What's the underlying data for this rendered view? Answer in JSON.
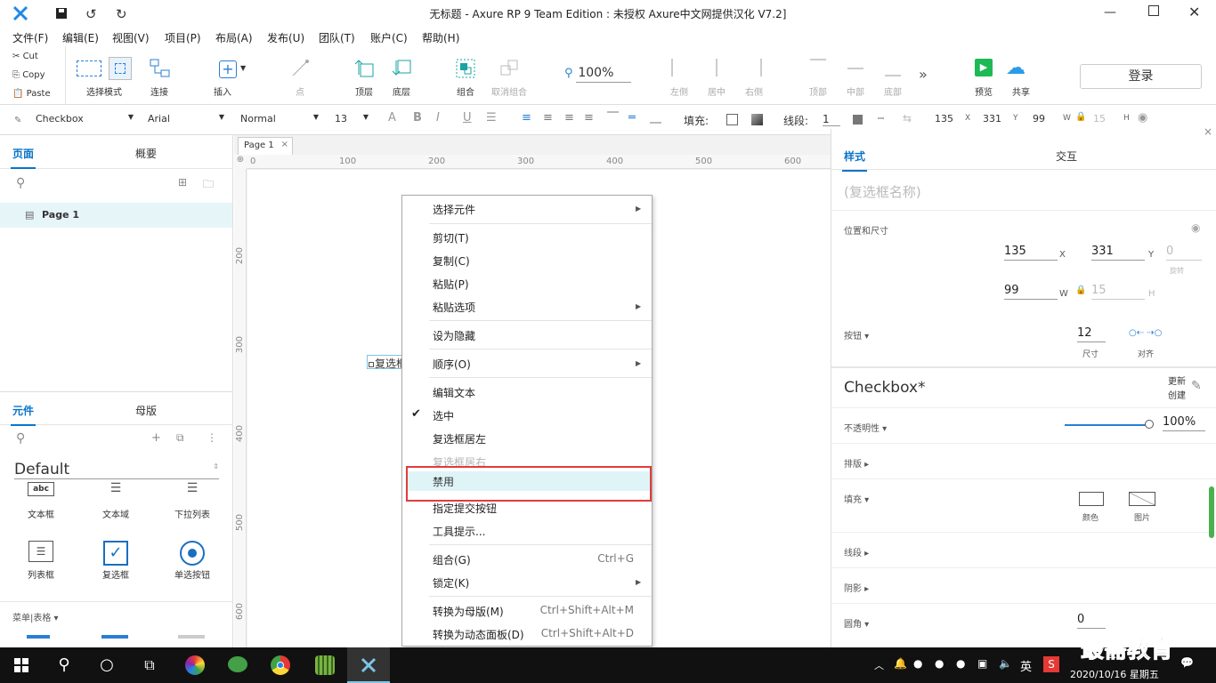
{
  "window": {
    "title": "无标题 - Axure RP 9 Team Edition : 未授权     Axure中文网提供汉化 V7.2]"
  },
  "menu": [
    "文件(F)",
    "编辑(E)",
    "视图(V)",
    "项目(P)",
    "布局(A)",
    "发布(U)",
    "团队(T)",
    "账户(C)",
    "帮助(H)"
  ],
  "clipboard": {
    "cut": "Cut",
    "copy": "Copy",
    "paste": "Paste"
  },
  "toolbar": {
    "select_mode": "选择模式",
    "connect": "连接",
    "insert": "插入",
    "point": "点",
    "top": "顶层",
    "bottom": "底层",
    "group": "组合",
    "ungroup": "取消组合",
    "zoom": "100%",
    "left": "左侧",
    "center": "居中",
    "right": "右侧",
    "top_align": "顶部",
    "middle": "中部",
    "bottom_align": "底部",
    "preview": "预览",
    "share": "共享",
    "login": "登录"
  },
  "format": {
    "widget": "Checkbox",
    "font": "Arial",
    "style": "Normal",
    "size": "13",
    "fill_label": "填充:",
    "line_label": "线段:",
    "line_val": "1",
    "x": "135",
    "x_lbl": "X",
    "y": "331",
    "y_lbl": "Y",
    "w": "99",
    "w_lbl": "W",
    "h": "15",
    "h_lbl": "H"
  },
  "left": {
    "pages_tab": "页面",
    "outline_tab": "概要",
    "page1": "Page 1",
    "widgets_tab": "元件",
    "masters_tab": "母版",
    "library": "Default",
    "widgets": [
      "文本框",
      "文本域",
      "下拉列表",
      "列表框",
      "复选框",
      "单选按钮"
    ],
    "abc_label": "abc",
    "menu_table": "菜单|表格"
  },
  "canvas": {
    "page_tab": "Page 1",
    "ruler_h": [
      "0",
      "100",
      "200",
      "300",
      "400",
      "500",
      "600"
    ],
    "ruler_v": [
      "200",
      "300",
      "400",
      "500",
      "600"
    ],
    "checkbox_text": "复选框"
  },
  "context_menu": [
    {
      "label": "选择元件",
      "submenu": true
    },
    {
      "sep": true
    },
    {
      "label": "剪切(T)"
    },
    {
      "label": "复制(C)"
    },
    {
      "label": "粘贴(P)"
    },
    {
      "label": "粘贴选项",
      "submenu": true
    },
    {
      "sep": true
    },
    {
      "label": "设为隐藏"
    },
    {
      "sep": true
    },
    {
      "label": "顺序(O)",
      "submenu": true
    },
    {
      "sep": true
    },
    {
      "label": "编辑文本"
    },
    {
      "label": "选中",
      "checked": true
    },
    {
      "label": "复选框居左"
    },
    {
      "label": "复选框居右",
      "disabled": true
    },
    {
      "label": "禁用",
      "highlight": true
    },
    {
      "label": "指定提交按钮"
    },
    {
      "label": "工具提示..."
    },
    {
      "sep": true
    },
    {
      "label": "组合(G)",
      "shortcut": "Ctrl+G"
    },
    {
      "label": "锁定(K)",
      "submenu": true
    },
    {
      "sep": true
    },
    {
      "label": "转换为母版(M)",
      "shortcut": "Ctrl+Shift+Alt+M"
    },
    {
      "label": "转换为动态面板(D)",
      "shortcut": "Ctrl+Shift+Alt+D"
    }
  ],
  "right": {
    "style_tab": "样式",
    "interact_tab": "交互",
    "name_placeholder": "(复选框名称)",
    "pos_size": "位置和尺寸",
    "x": "135",
    "y": "331",
    "rot": "0",
    "rot_lbl": "旋转",
    "w": "99",
    "h": "15",
    "button_lbl": "按钮",
    "size_val": "12",
    "size_lbl": "尺寸",
    "align_lbl": "对齐",
    "style_name": "Checkbox*",
    "update": "更新",
    "create": "创建",
    "opacity_lbl": "不透明性",
    "opacity": "100%",
    "typeset": "排版",
    "fill": "填充",
    "color": "颜色",
    "image": "图片",
    "line": "线段",
    "shadow": "阴影",
    "corner": "圆角",
    "corner_val": "0"
  },
  "taskbar": {
    "ime": "英",
    "datetime": "2020/10/16 星期五",
    "time": "9:",
    "watermark": "最需教育"
  }
}
